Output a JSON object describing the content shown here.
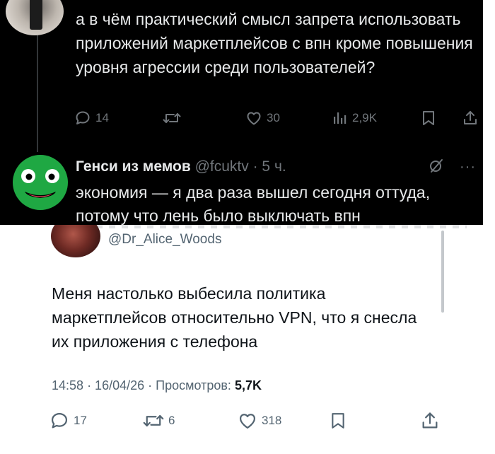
{
  "top_panel": {
    "tweet1": {
      "text": "а в чём практический смысл запрета использовать приложений маркетплейсов с впн кроме повышения уровня агрессии среди пользователей?",
      "actions": {
        "replies": "14",
        "reposts": "",
        "likes": "30",
        "views": "2,9K"
      }
    },
    "tweet2": {
      "author_name": "Генси из мемов",
      "author_handle": "@fcuktv",
      "time": "· 5 ч.",
      "text": "экономия — я два раза вышел сегодня оттуда, потому что лень было выключать впн"
    }
  },
  "bottom_panel": {
    "handle": "@Dr_Alice_Woods",
    "text": "Меня настолько выбесила политика маркетплейсов относительно VPN, что я снесла их приложения с телефона",
    "meta": {
      "time": "14:58",
      "date": "· 16/04/26 ·",
      "views_label": "Просмотров:",
      "views_value": "5,7K"
    },
    "actions": {
      "replies": "17",
      "reposts": "6",
      "likes": "318"
    }
  },
  "colors": {
    "dark_bg": "#000000",
    "dark_text": "#e7e9ea",
    "dark_secondary": "#71767b",
    "light_text": "#0f1419",
    "light_secondary": "#536471",
    "frog_green": "#1fa843"
  },
  "icons": [
    "reply-icon",
    "repost-icon",
    "like-icon",
    "views-icon",
    "bookmark-icon",
    "share-icon",
    "grok-icon",
    "more-icon"
  ]
}
